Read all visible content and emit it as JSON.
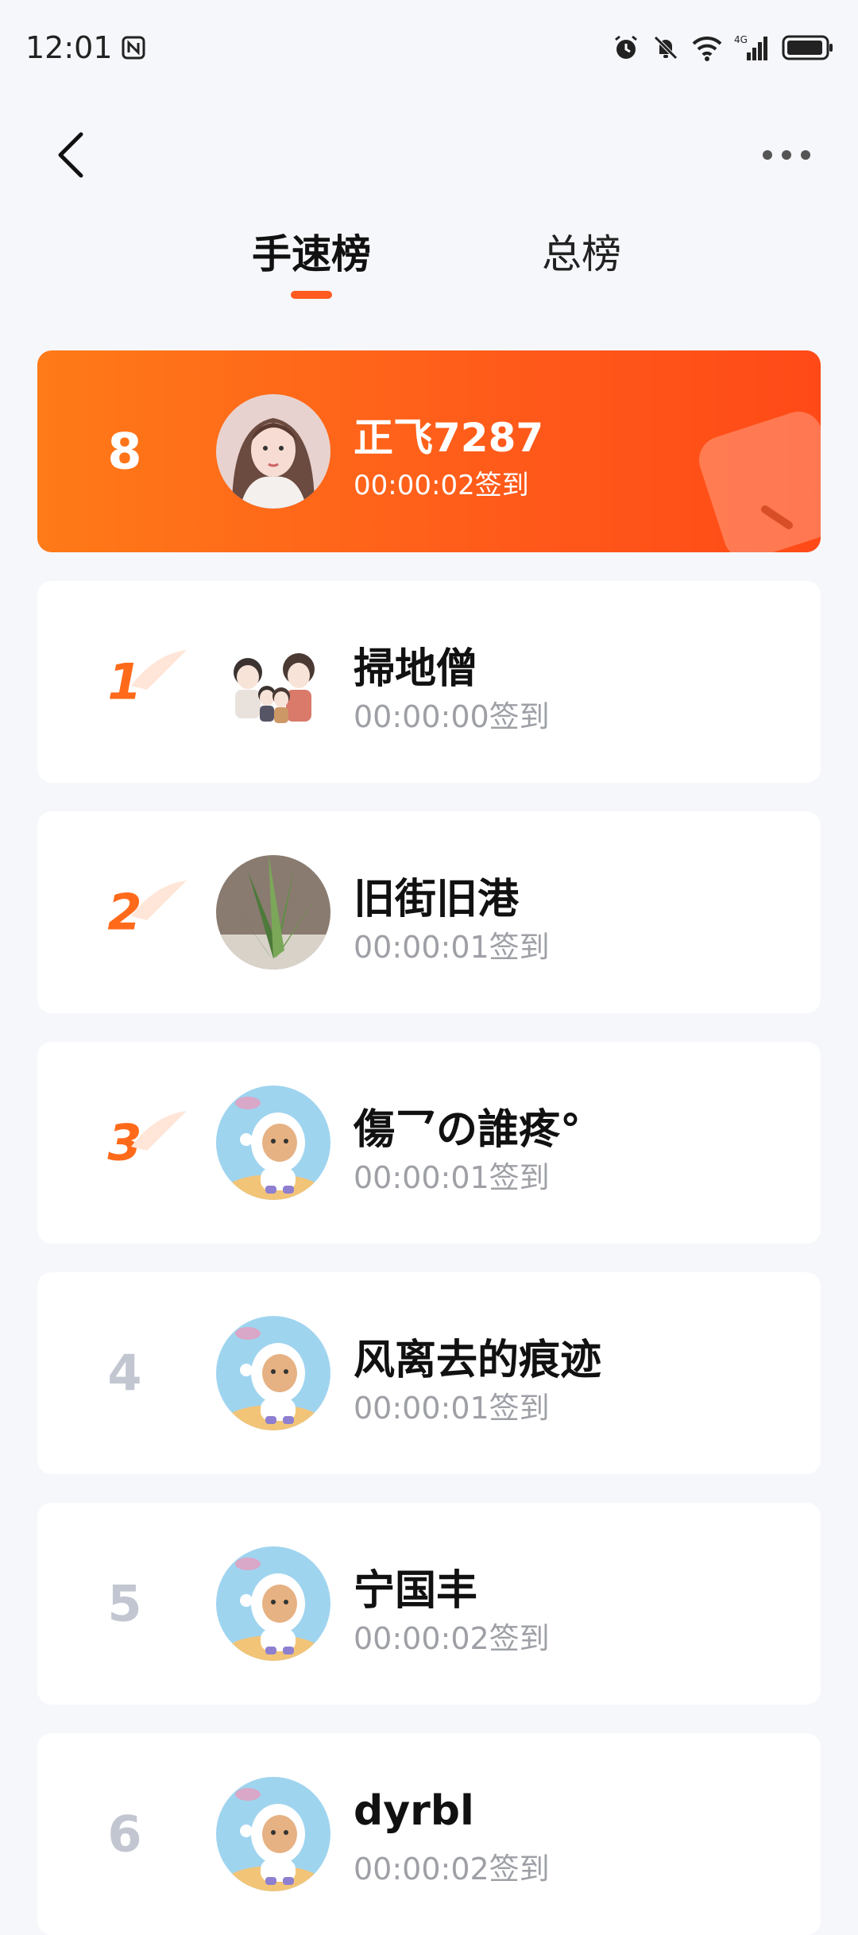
{
  "status_bar": {
    "time": "12:01",
    "network": "4G"
  },
  "nav": {
    "back_icon": "chevron-left-icon",
    "more_icon": "more-dots-icon"
  },
  "tabs": [
    {
      "label": "手速榜",
      "active": true
    },
    {
      "label": "总榜",
      "active": false
    }
  ],
  "my_rank": {
    "rank": "8",
    "name": "正飞7287",
    "time": "00:00:02签到"
  },
  "leaderboard": [
    {
      "rank": "1",
      "name": "掃地僧",
      "time": "00:00:00签到",
      "avatar": "family-cartoon-avatar"
    },
    {
      "rank": "2",
      "name": "旧街旧港",
      "time": "00:00:01签到",
      "avatar": "plant-avatar"
    },
    {
      "rank": "3",
      "name": "傷乛の誰疼°",
      "time": "00:00:01签到",
      "avatar": "astronaut-avatar"
    },
    {
      "rank": "4",
      "name": "风离去的痕迹",
      "time": "00:00:01签到",
      "avatar": "astronaut-avatar"
    },
    {
      "rank": "5",
      "name": "宁国丰",
      "time": "00:00:02签到",
      "avatar": "astronaut-avatar"
    },
    {
      "rank": "6",
      "name": "dyrbl",
      "time": "00:00:02签到",
      "avatar": "astronaut-avatar"
    }
  ],
  "colors": {
    "accent": "#ff5a1f",
    "background": "#f6f7fb",
    "rank_gray": "#c2c6d1",
    "time_gray": "#9ea0a6"
  }
}
